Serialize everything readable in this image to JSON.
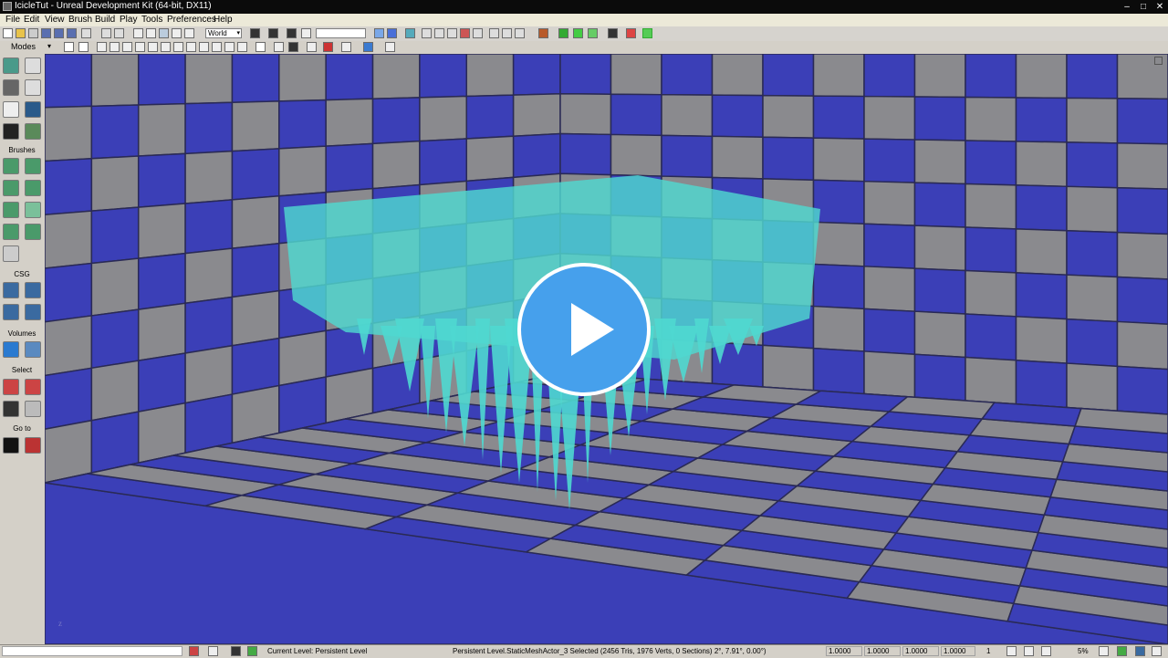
{
  "window": {
    "title": "IcicleTut - Unreal Development Kit (64-bit, DX11)",
    "minimize": "–",
    "maximize": "□",
    "close": "✕"
  },
  "menu": [
    "File",
    "Edit",
    "View",
    "Brush",
    "Build",
    "Play",
    "Tools",
    "Preferences",
    "Help"
  ],
  "toolbar": {
    "coord_system": "World",
    "dropdown_arrow": "▾"
  },
  "modes": {
    "label": "Modes",
    "arrow": "▾"
  },
  "sidebar": {
    "sections": [
      "Brushes",
      "CSG",
      "Volumes",
      "Select",
      "Go to"
    ]
  },
  "viewport": {
    "axis_label": "z",
    "play_icon": "play-icon",
    "checker_blue": "#3b3fb7",
    "checker_gray": "#8a8a8e",
    "icicle_color": "#4fd8d0"
  },
  "status": {
    "current_level": "Current Level:  Persistent Level",
    "selection": "Persistent Level.StaticMeshActor_3 Selected (2456 Tris, 1976 Verts, 0 Sections) 2°, 7.91°, 0.00°)",
    "scale_x": "1.0000",
    "scale_y": "1.0000",
    "scale_z": "1.0000",
    "scale_all": "1.0000",
    "grid": "1",
    "percent": "5%"
  }
}
